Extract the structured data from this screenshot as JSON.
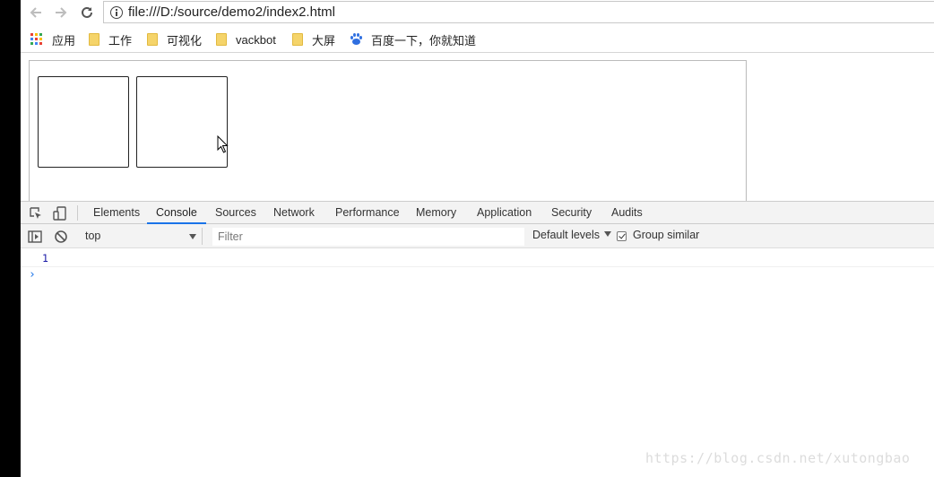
{
  "browser": {
    "url": "file:///D:/source/demo2/index2.html",
    "bookmarks": [
      {
        "label": "应用",
        "icon": "apps-grid-icon"
      },
      {
        "label": "工作",
        "icon": "folder-icon"
      },
      {
        "label": "可视化",
        "icon": "folder-icon"
      },
      {
        "label": "vackbot",
        "icon": "folder-icon"
      },
      {
        "label": "大屏",
        "icon": "folder-icon"
      },
      {
        "label": "百度一下，你就知道",
        "icon": "baidu-paw-icon"
      }
    ]
  },
  "devtools": {
    "tabs": [
      "Elements",
      "Console",
      "Sources",
      "Network",
      "Performance",
      "Memory",
      "Application",
      "Security",
      "Audits"
    ],
    "active_tab": "Console",
    "context": "top",
    "filter_placeholder": "Filter",
    "levels_label": "Default levels",
    "group_similar_label": "Group similar",
    "group_similar_checked": true,
    "log_value": "1",
    "prompt_symbol": "›"
  },
  "colors": {
    "accent": "#1a73e8",
    "log_number": "#1a1aa6",
    "folder": "#f5d46a"
  },
  "watermark": "https://blog.csdn.net/xutongbao"
}
